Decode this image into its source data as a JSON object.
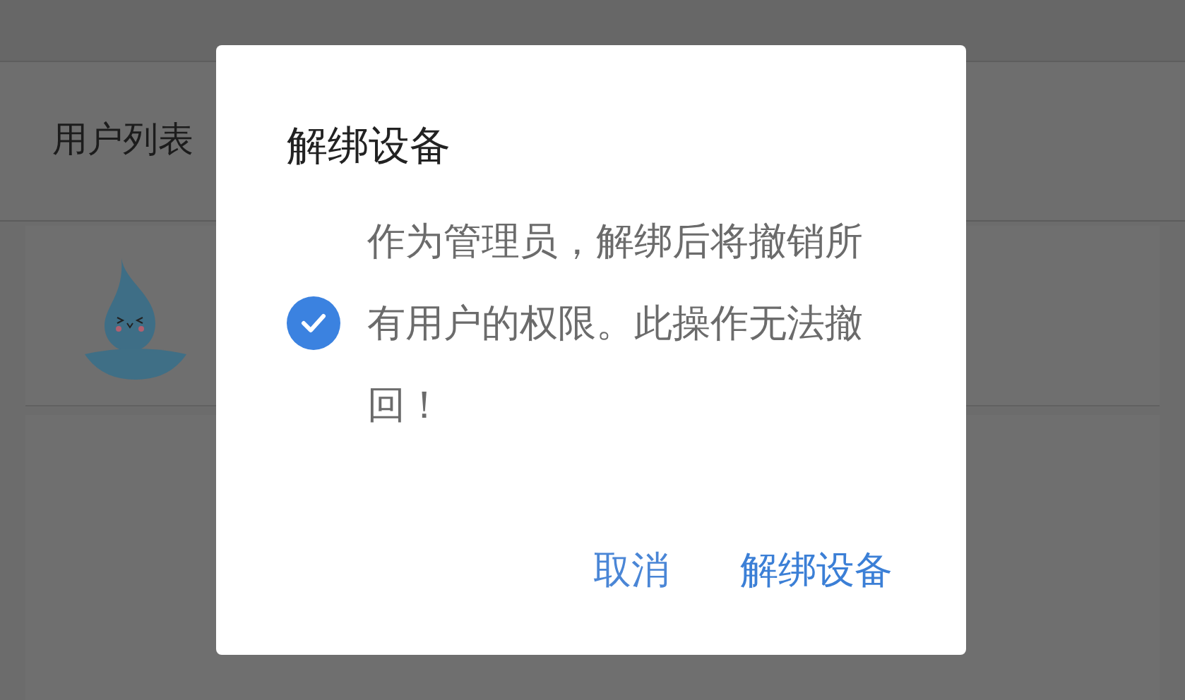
{
  "page": {
    "title": "用户列表"
  },
  "dialog": {
    "title": "解绑设备",
    "checked": true,
    "message": "作为管理员，解绑后将撤销所有用户的权限。此操作无法撤回！",
    "buttons": [
      {
        "label": "取消",
        "kind": "cancel"
      },
      {
        "label": "解绑设备",
        "kind": "confirm"
      }
    ]
  }
}
